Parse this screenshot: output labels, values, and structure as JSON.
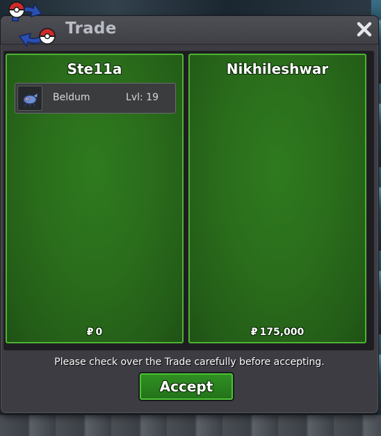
{
  "window": {
    "title": "Trade",
    "close_icon": "close-icon",
    "logo_icon": "trade-swap-pokeball-icon"
  },
  "left_offer": {
    "player_name": "Ste11a",
    "pokemon": [
      {
        "name": "Beldum",
        "level": "Lvl: 19",
        "icon": "beldum-sprite-icon"
      }
    ],
    "currency_symbol": "₽",
    "money": "0"
  },
  "right_offer": {
    "player_name": "Nikhileshwar",
    "pokemon": [],
    "currency_symbol": "₽",
    "money": "175,000"
  },
  "notice": "Please check over the Trade carefully before accepting.",
  "accept_label": "Accept",
  "colors": {
    "panel_green": "#2a6d1b",
    "panel_border": "#4fb333",
    "window_bg": "#3c3c42",
    "logo_blue": "#2a4fb0",
    "logo_red": "#d12a2a"
  }
}
